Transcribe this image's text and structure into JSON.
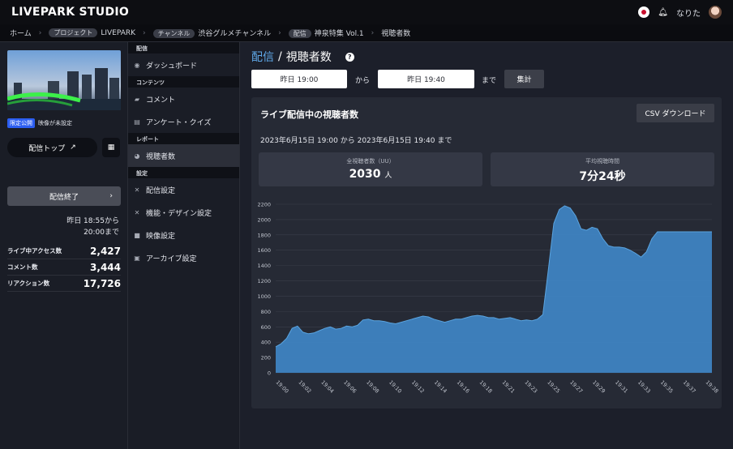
{
  "app": {
    "brand": "LIVEPARK STUDIO",
    "username": "なりた"
  },
  "breadcrumb": {
    "home": "ホーム",
    "project_tag": "プロジェクト",
    "project": "LIVEPARK",
    "channel_tag": "チャンネル",
    "channel": "渋谷グルメチャンネル",
    "stream_tag": "配信",
    "stream": "神泉特集 Vol.1",
    "current": "視聴者数"
  },
  "left": {
    "badge_limited": "限定公開",
    "badge_video": "映像が未設定",
    "top_button": "配信トップ",
    "end_button": "配信終了",
    "period_line1": "昨日 18:55から",
    "period_line2": "20:00まで",
    "stats": [
      {
        "label": "ライブ中アクセス数",
        "value": "2,427"
      },
      {
        "label": "コメント数",
        "value": "3,444"
      },
      {
        "label": "リアクション数",
        "value": "17,726"
      }
    ]
  },
  "nav": {
    "sec_stream": "配信",
    "dashboard": "ダッシュボード",
    "sec_contents": "コンテンツ",
    "comment": "コメント",
    "survey": "アンケート・クイズ",
    "sec_report": "レポート",
    "viewers": "視聴者数",
    "sec_settings": "設定",
    "stream_settings": "配信設定",
    "design_settings": "機能・デザイン設定",
    "video_settings": "映像設定",
    "archive_settings": "アーカイブ設定"
  },
  "main": {
    "title_accent": "配信",
    "title_sep": "/",
    "title": "視聴者数",
    "from_value": "昨日 19:00",
    "from_label": "から",
    "to_value": "昨日 19:40",
    "to_label": "まで",
    "aggregate_button": "集計",
    "card_title": "ライブ配信中の視聴者数",
    "csv_button": "CSV ダウンロード",
    "range_text": "2023年6月15日 19:00 から 2023年6月15日 19:40 まで",
    "kpi_uu_label": "全視聴者数（UU）",
    "kpi_uu_value": "2030",
    "kpi_uu_unit": "人",
    "kpi_avg_label": "平均視聴時間",
    "kpi_avg_value": "7分24秒"
  },
  "colors": {
    "accent": "#5fa8e8",
    "area_fill": "#3f86c6",
    "area_stroke": "#5aa4e0",
    "badge_blue": "#2c5ef0"
  },
  "chart_data": {
    "type": "area",
    "y_ticks": [
      0,
      200,
      400,
      600,
      800,
      1000,
      1200,
      1400,
      1600,
      1800,
      2000,
      2200
    ],
    "ylim": [
      0,
      2200
    ],
    "x_tick_labels": [
      "19:00",
      "19:02",
      "19:04",
      "19:06",
      "19:08",
      "19:10",
      "19:12",
      "19:14",
      "19:16",
      "19:18",
      "19:21",
      "19:23",
      "19:25",
      "19:27",
      "19:29",
      "19:31",
      "19:33",
      "19:35",
      "19:37",
      "19:38"
    ],
    "x": [
      0,
      1,
      2,
      3,
      4,
      5,
      6,
      7,
      8,
      9,
      10,
      11,
      12,
      13,
      14,
      15,
      16,
      17,
      18,
      19,
      20,
      21,
      22,
      23,
      24,
      25,
      26,
      27,
      28,
      29,
      30,
      31,
      32,
      33,
      34,
      35,
      36,
      37,
      38,
      39,
      40,
      41,
      42,
      43,
      44,
      45,
      46,
      47,
      48,
      49,
      50,
      51,
      52,
      53,
      54,
      55,
      56,
      57,
      58,
      59,
      60,
      61,
      62,
      63,
      64,
      65,
      66,
      67,
      68,
      69,
      70,
      71,
      72,
      73,
      74,
      75,
      76,
      77,
      78,
      79,
      80
    ],
    "values": [
      340,
      380,
      450,
      580,
      610,
      530,
      510,
      520,
      550,
      580,
      600,
      570,
      580,
      610,
      600,
      620,
      690,
      700,
      680,
      680,
      670,
      650,
      640,
      660,
      680,
      700,
      720,
      740,
      730,
      700,
      680,
      660,
      680,
      700,
      700,
      720,
      740,
      750,
      740,
      720,
      720,
      700,
      710,
      720,
      700,
      680,
      690,
      680,
      700,
      760,
      1350,
      1950,
      2130,
      2180,
      2150,
      2050,
      1880,
      1860,
      1900,
      1880,
      1750,
      1660,
      1640,
      1640,
      1630,
      1600,
      1560,
      1510,
      1580,
      1750,
      1840,
      1840,
      1840,
      1840,
      1840,
      1840,
      1840,
      1840,
      1840,
      1840,
      1840
    ],
    "grid": true
  }
}
